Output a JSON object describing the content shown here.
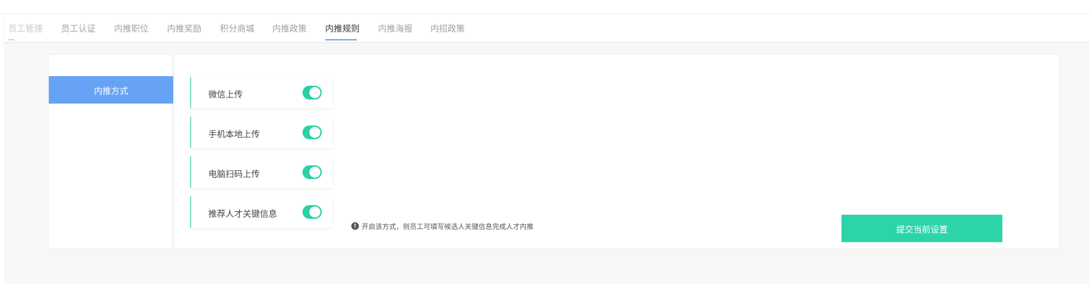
{
  "tabs": [
    {
      "label": "员工管理",
      "state": "faded"
    },
    {
      "label": "员工认证",
      "state": "normal"
    },
    {
      "label": "内推职位",
      "state": "normal"
    },
    {
      "label": "内推奖励",
      "state": "normal"
    },
    {
      "label": "积分商城",
      "state": "normal"
    },
    {
      "label": "内推政策",
      "state": "normal"
    },
    {
      "label": "内推规则",
      "state": "active"
    },
    {
      "label": "内推海报",
      "state": "normal"
    },
    {
      "label": "内招政策",
      "state": "normal"
    }
  ],
  "sidebar": {
    "items": [
      {
        "label": "内推方式",
        "selected": true
      }
    ]
  },
  "options": [
    {
      "label": "微信上传",
      "enabled": true
    },
    {
      "label": "手机本地上传",
      "enabled": true
    },
    {
      "label": "电脑扫码上传",
      "enabled": true
    },
    {
      "label": "推荐人才关键信息",
      "enabled": true
    }
  ],
  "hint": {
    "icon": "info-icon",
    "text": "开启该方式，则员工可填写候选人关键信息完成人才内推"
  },
  "submit_label": "提交当前设置",
  "colors": {
    "accent_green": "#2dd4aa",
    "sidebar_active": "#66a3f5",
    "tab_underline": "#7aa6e6"
  }
}
